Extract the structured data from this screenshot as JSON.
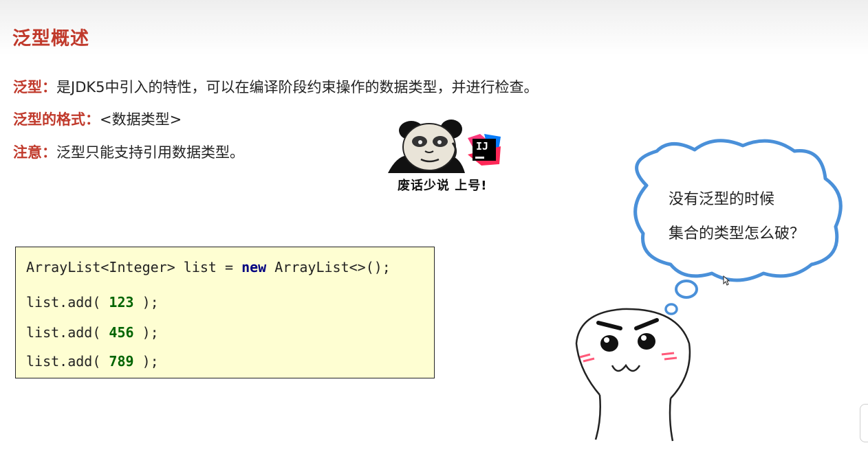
{
  "slide": {
    "title": "泛型概述",
    "lines": [
      {
        "key": "泛型：",
        "text": "是JDK5中引入的特性，可以在编译阶段约束操作的数据类型，并进行检查。"
      },
      {
        "key": "泛型的格式：",
        "text": "<数据类型>"
      },
      {
        "key": "注意：",
        "text": "泛型只能支持引用数据类型。"
      }
    ]
  },
  "meme": {
    "caption": "废话少说 上号!",
    "logo_text": "IJ",
    "icon": "intellij-logo-icon"
  },
  "code": {
    "line1_pre": "ArrayList<Integer> list = ",
    "line1_kw": "new",
    "line1_post": " ArrayList<>();",
    "add_prefix": "list.add( ",
    "add_suffix": " );",
    "values": [
      "123",
      "456",
      "789"
    ]
  },
  "cloud": {
    "line1": "没有泛型的时候",
    "line2": "集合的类型怎么破？"
  },
  "colors": {
    "accent": "#c0392b",
    "keyword": "#000080",
    "number": "#006400",
    "code_bg": "#fefed2",
    "cloud_stroke": "#4a90d9"
  }
}
